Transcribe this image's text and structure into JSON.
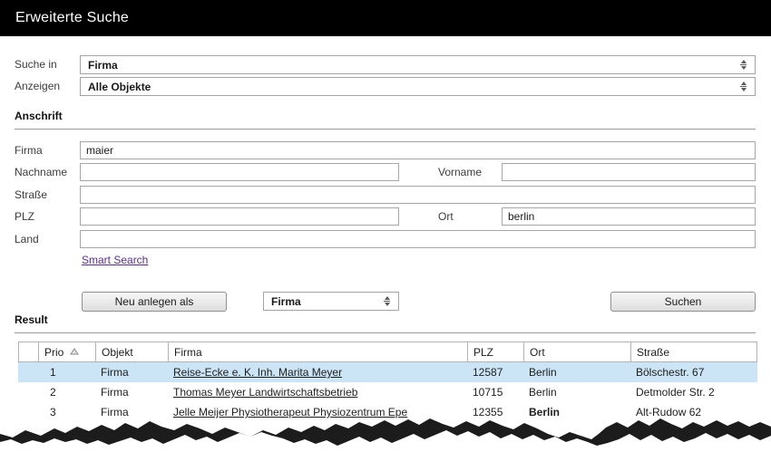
{
  "header": {
    "title": "Erweiterte Suche"
  },
  "search_controls": {
    "suche_in": {
      "label": "Suche in",
      "value": "Firma"
    },
    "anzeigen": {
      "label": "Anzeigen",
      "value": "Alle Objekte"
    }
  },
  "anschrift": {
    "section_title": "Anschrift",
    "fields": {
      "firma": {
        "label": "Firma",
        "value": "maier"
      },
      "nachname": {
        "label": "Nachname",
        "value": ""
      },
      "vorname": {
        "label": "Vorname",
        "value": ""
      },
      "strasse": {
        "label": "Straße",
        "value": ""
      },
      "plz": {
        "label": "PLZ",
        "value": ""
      },
      "ort": {
        "label": "Ort",
        "value": "berlin"
      },
      "land": {
        "label": "Land",
        "value": ""
      }
    },
    "smart_search_label": "Smart Search"
  },
  "actions": {
    "neu_anlegen_label": "Neu anlegen als",
    "type_select_value": "Firma",
    "suchen_label": "Suchen"
  },
  "result": {
    "section_title": "Result",
    "columns": [
      "",
      "Prio",
      "Objekt",
      "Firma",
      "PLZ",
      "Ort",
      "Straße"
    ],
    "rows": [
      {
        "prio": "1",
        "objekt": "Firma",
        "firma": "Reise-Ecke e. K. Inh. Marita Meyer",
        "plz": "12587",
        "ort": "Berlin",
        "strasse": "Bölschestr. 67",
        "selected": true,
        "ort_bold": false
      },
      {
        "prio": "2",
        "objekt": "Firma",
        "firma": "Thomas Meyer Landwirtschaftsbetrieb",
        "plz": "10715",
        "ort": "Berlin",
        "strasse": "Detmolder Str. 2",
        "selected": false,
        "ort_bold": false
      },
      {
        "prio": "3",
        "objekt": "Firma",
        "firma": "Jelle Meijer Physiotherapeut Physiozentrum Epe",
        "plz": "12355",
        "ort": "Berlin",
        "strasse": "Alt-Rudow 62",
        "selected": false,
        "ort_bold": true
      }
    ]
  },
  "colors": {
    "titlebar_bg": "#000000",
    "selected_row_bg": "#cbe5f6",
    "smart_search_link": "#5b2f91",
    "input_border": "#a6a6a6"
  }
}
